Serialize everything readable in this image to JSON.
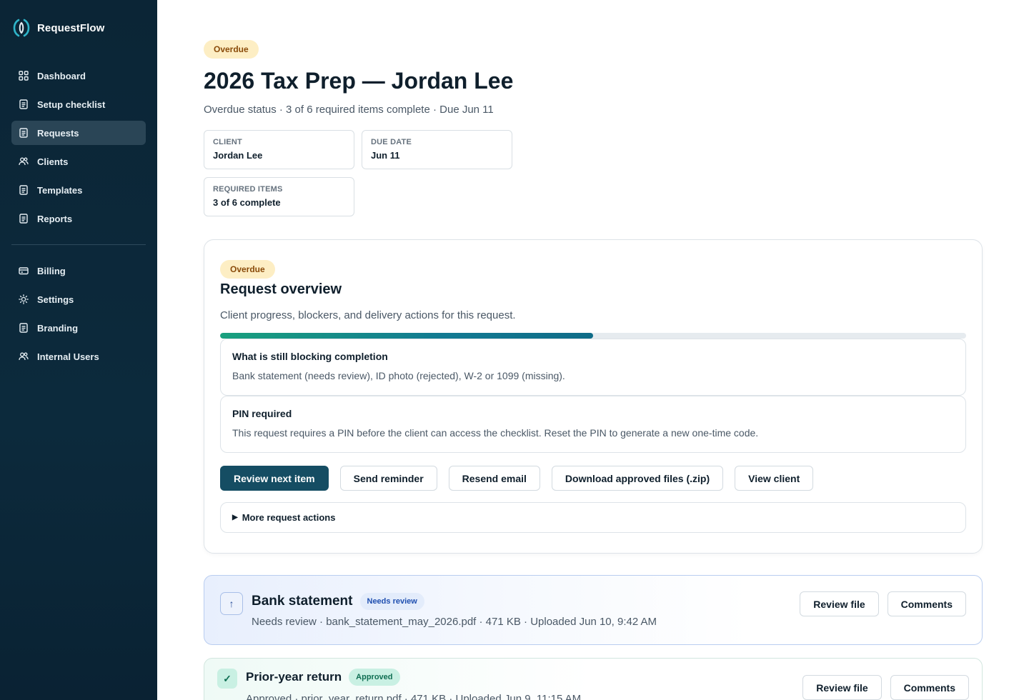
{
  "app": {
    "name": "RequestFlow",
    "accent": "#154d63"
  },
  "sidebar": {
    "primary": [
      {
        "label": "Dashboard",
        "icon": "grid-icon"
      },
      {
        "label": "Setup checklist",
        "icon": "document-icon"
      },
      {
        "label": "Requests",
        "icon": "document-icon",
        "active": true
      },
      {
        "label": "Clients",
        "icon": "users-icon"
      },
      {
        "label": "Templates",
        "icon": "document-icon"
      },
      {
        "label": "Reports",
        "icon": "document-icon"
      }
    ],
    "secondary": [
      {
        "label": "Billing",
        "icon": "card-icon"
      },
      {
        "label": "Settings",
        "icon": "sun-icon"
      },
      {
        "label": "Branding",
        "icon": "document-icon"
      },
      {
        "label": "Internal Users",
        "icon": "users-icon"
      }
    ]
  },
  "header": {
    "status_badge": "Overdue",
    "title": "2026 Tax Prep — Jordan Lee",
    "subtitle": "Overdue status · 3 of 6 required items complete · Due Jun 11"
  },
  "info": {
    "client": {
      "label": "Client",
      "value": "Jordan Lee"
    },
    "due_date": {
      "label": "Due date",
      "value": "Jun 11"
    },
    "required": {
      "label": "Required items",
      "value": "3 of 6 complete"
    }
  },
  "overview": {
    "badge": "Overdue",
    "title": "Request overview",
    "description": "Client progress, blockers, and delivery actions for this request.",
    "progress_fraction": 0.5,
    "blocking": {
      "title": "What is still blocking completion",
      "text": "Bank statement (needs review), ID photo (rejected), W-2 or 1099 (missing)."
    },
    "pin": {
      "title": "PIN required",
      "text": "This request requires a PIN before the client can access the checklist. Reset the PIN to generate a new one-time code."
    },
    "actions": {
      "review_next": "Review next item",
      "send_reminder": "Send reminder",
      "resend_email": "Resend email",
      "download_zip": "Download approved files (.zip)",
      "view_client": "View client"
    },
    "more_actions": "More request actions"
  },
  "items": [
    {
      "title": "Bank statement",
      "status": "Needs review",
      "meta": "Needs review · bank_statement_may_2026.pdf · 471 KB · Uploaded Jun 10, 9:42 AM",
      "icon": "upload-arrow-icon",
      "review_label": "Review file",
      "comments_label": "Comments"
    },
    {
      "title": "Prior-year return",
      "status": "Approved",
      "meta": "Approved · prior_year_return.pdf · 471 KB · Uploaded Jun 9, 11:15 AM",
      "icon": "check-icon",
      "review_label": "Review file",
      "comments_label": "Comments"
    }
  ]
}
